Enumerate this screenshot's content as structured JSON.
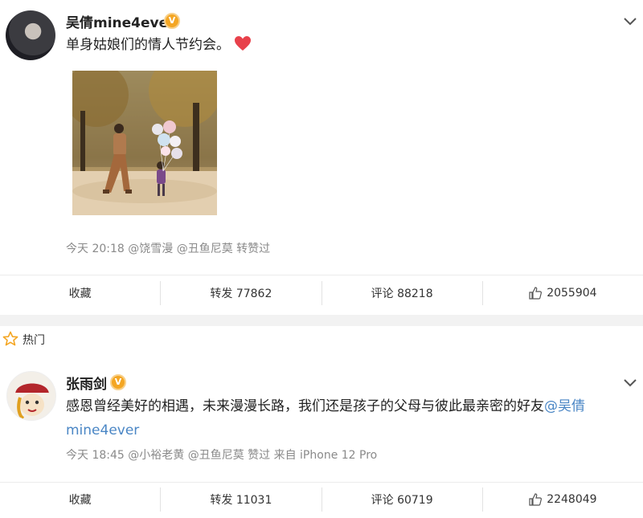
{
  "posts": [
    {
      "username": "吴倩mine4ever",
      "text": "单身姑娘们的情人节约会。",
      "meta": "今天 20:18 @饶雪漫 @丑鱼尼莫 转赞过",
      "actions": {
        "favorite": "收藏",
        "repost": "转发 77862",
        "comment": "评论 88218",
        "like": "2055904"
      }
    },
    {
      "username": "张雨剑",
      "text": "感恩曾经美好的相遇，未来漫漫长路，我们还是孩子的父母与彼此最亲密的好友",
      "mention_part1": "@吴倩",
      "mention_part2": "mine4ever",
      "meta": "今天 18:45 @小裕老黄 @丑鱼尼莫 赞过  来自 iPhone 12 Pro",
      "actions": {
        "favorite": "收藏",
        "repost": "转发 11031",
        "comment": "评论 60719",
        "like": "2248049"
      }
    }
  ],
  "section": {
    "hot_label": "热门"
  },
  "colors": {
    "mention": "#4a86c5",
    "verified": "#f4a623",
    "heart": "#e8414b"
  }
}
